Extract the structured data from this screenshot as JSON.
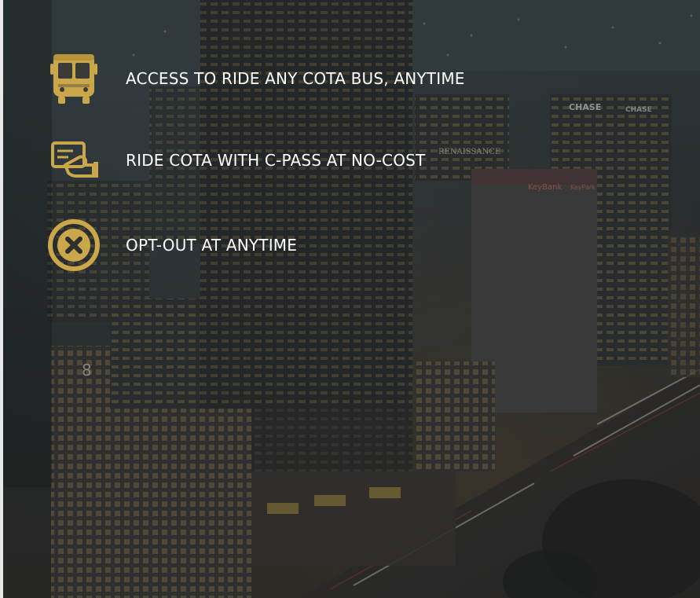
{
  "accent_color": "#c9a74a",
  "features": [
    {
      "icon": "bus-icon",
      "label": "ACCESS TO RIDE ANY COTA BUS, ANYTIME"
    },
    {
      "icon": "card-payment-icon",
      "label": "RIDE COTA WITH C-PASS AT NO-COST"
    },
    {
      "icon": "close-circle-icon",
      "label": "OPT-OUT AT ANYTIME"
    }
  ],
  "background": {
    "signs": [
      "CHASE",
      "CHASE",
      "RENAISSANCE",
      "KeyBank",
      "KeyPark",
      "8"
    ]
  }
}
